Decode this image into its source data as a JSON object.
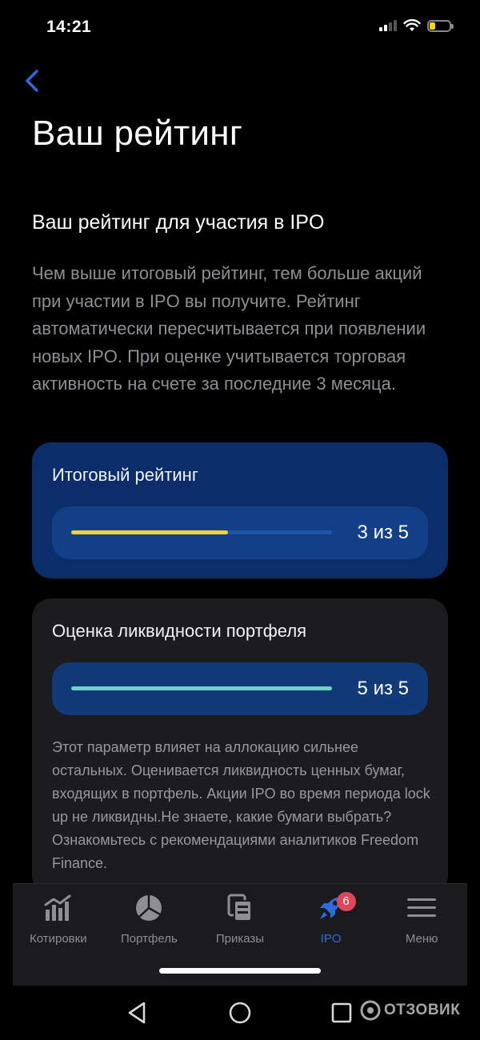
{
  "status_bar": {
    "time": "14:21",
    "battery_level": 0.3,
    "battery_color": "#f5d60a"
  },
  "header": {
    "back_icon": "chevron-left-icon",
    "title": "Ваш рейтинг"
  },
  "section": {
    "title": "Ваш рейтинг для участия в IPO",
    "description": "Чем выше итоговый рейтинг, тем больше акций при участии в IPO вы получите. Рейтинг автоматически пересчитывается при появлении новых IPO. При оценке учитывается торговая активность на счете за последние 3 месяца."
  },
  "total_rating": {
    "title": "Итоговый рейтинг",
    "value": 3,
    "max": 5,
    "label": "3 из 5",
    "bar_color": "#f0d236"
  },
  "liquidity_rating": {
    "title": "Оценка ликвидности портфеля",
    "value": 5,
    "max": 5,
    "label": "5 из 5",
    "bar_color": "#6fd2c4",
    "note": "Этот параметр влияет на аллокацию сильнее остальных. Оценивается ликвидность ценных бумаг, входящих в портфель. Акции IPO во время периода lock up не ликвидны.Не знаете, какие бумаги выбрать? Ознакомьтесь с рекомендациями аналитиков Freedom Finance."
  },
  "tab_bar": {
    "accent_color": "#2d6cdf",
    "tabs": [
      {
        "label": "Котировки",
        "icon": "bar-chart-icon"
      },
      {
        "label": "Портфель",
        "icon": "pie-chart-icon"
      },
      {
        "label": "Приказы",
        "icon": "documents-icon"
      },
      {
        "label": "IPO",
        "icon": "rocket-icon",
        "badge": "6",
        "active": true
      },
      {
        "label": "Меню",
        "icon": "menu-icon"
      }
    ]
  },
  "watermark": {
    "text": "ОТЗОВИК"
  }
}
